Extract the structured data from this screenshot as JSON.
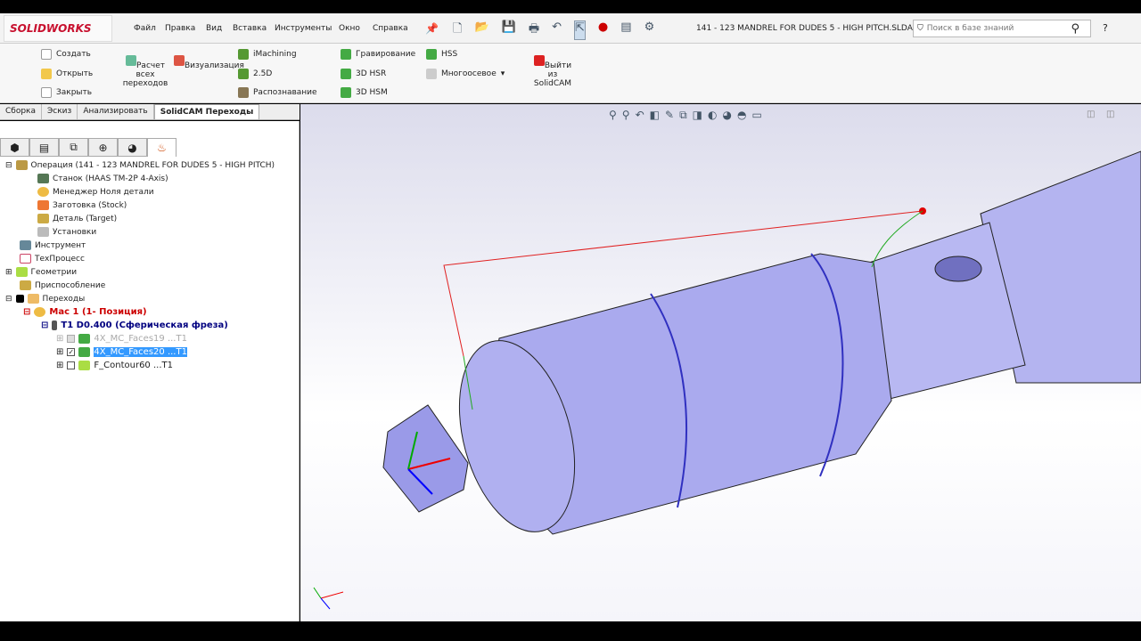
{
  "app": {
    "logo": "SOLIDWORKS",
    "document_title": "141 - 123 MANDREL FOR DUDES 5 - HIGH PITCH.SLDA...",
    "search_placeholder": "Поиск в базе знаний",
    "help": "?"
  },
  "menu": [
    "Файл",
    "Правка",
    "Вид",
    "Вставка",
    "Инструменты",
    "Окно",
    "Справка"
  ],
  "ribbon": {
    "file": [
      "Создать",
      "Открыть",
      "Закрыть"
    ],
    "calc": "Расчет всех переходов",
    "visual": "Визуализация",
    "ops1": [
      "iMachining",
      "2.5D",
      "Распознавание"
    ],
    "ops2": [
      "Гравирование",
      "3D HSR",
      "3D HSM"
    ],
    "ops3": [
      "HSS",
      "Многоосевое"
    ],
    "exit": "Выйти из SolidCAM"
  },
  "tabs": [
    "Сборка",
    "Эскиз",
    "Анализировать",
    "SolidCAM Переходы"
  ],
  "tree": [
    {
      "label": "Операция (141 - 123 MANDREL FOR DUDES 5 - HIGH PITCH)",
      "color": "#222"
    },
    {
      "label": "Станок (HAAS TM-2P 4-Axis)"
    },
    {
      "label": "Менеджер Ноля детали"
    },
    {
      "label": "Заготовка (Stock)"
    },
    {
      "label": "Деталь (Target)"
    },
    {
      "label": "Установки"
    },
    {
      "label": "Инструмент"
    },
    {
      "label": "ТехПроцесс"
    },
    {
      "label": "Геометрии"
    },
    {
      "label": "Приспособление"
    },
    {
      "label": "Переходы"
    },
    {
      "label": "Мас 1 (1- Позиция)",
      "color": "#cc0000"
    },
    {
      "label": "T1  D0.400  (Сферическая фреза)",
      "color": "#000080"
    },
    {
      "label": "4X_MC_Faces19 ...T1",
      "color": "#aaaaaa"
    },
    {
      "label": "4X_MC_Faces20 ...T1",
      "selected": true
    },
    {
      "label": "F_Contour60 ...T1"
    }
  ]
}
